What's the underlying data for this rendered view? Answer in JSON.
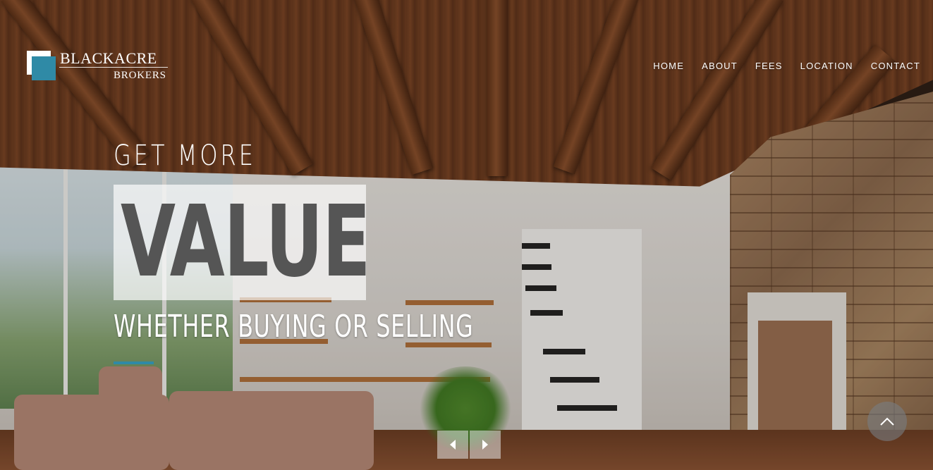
{
  "brand": {
    "name": "BLACKACRE",
    "sub": "BROKERS",
    "accent_color": "#2f8aa6"
  },
  "nav": {
    "items": [
      {
        "label": "HOME"
      },
      {
        "label": "ABOUT"
      },
      {
        "label": "FEES"
      },
      {
        "label": "LOCATION"
      },
      {
        "label": "CONTACT"
      }
    ]
  },
  "hero": {
    "pre_title": "GET MORE",
    "title": "VALUE",
    "subtitle": "WHETHER BUYING OR SELLING"
  },
  "slider": {
    "prev_icon": "arrow-left-icon",
    "next_icon": "arrow-right-icon"
  },
  "back_to_top": {
    "icon": "chevron-up-icon"
  }
}
